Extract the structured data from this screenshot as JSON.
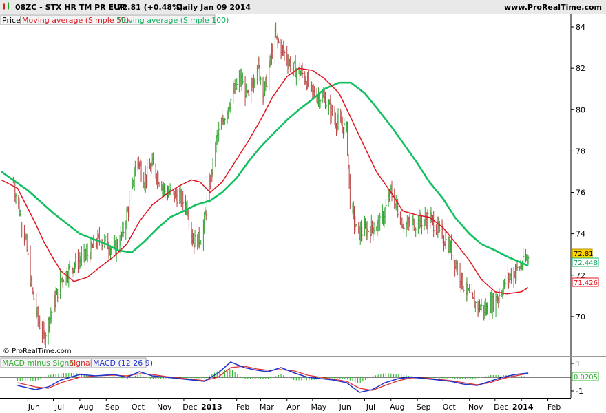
{
  "header": {
    "symbol": "08ZC - STX HR TM PR EUR",
    "price": "72.81 (+0.48%)",
    "period": "Daily  Jan 09 2014",
    "site": "www.ProRealTime.com"
  },
  "legend_main": {
    "price": "Price",
    "ma50": "Moving average (Simple 50)",
    "ma100": "Moving average (Simple 100)"
  },
  "legend_macd": {
    "hist": "MACD minus Signal",
    "signal": "Signal",
    "macd": "MACD (12 26 9)"
  },
  "watermark": "© ProRealTime.com",
  "colors": {
    "bars": "#2fa32f",
    "bars_down": "#b84040",
    "ma50": "#e0141e",
    "ma100": "#12c060",
    "macd": "#2233cc",
    "signal": "#e03030",
    "hist": "#33bb33",
    "last_price_bg": "#ffd400"
  },
  "chart_data": [
    {
      "type": "line",
      "subtype": "ohlc-bars",
      "title": "08ZC - STX HR TM PR EUR",
      "x_tick_labels": [
        "Jun",
        "Jul",
        "Aug",
        "Sep",
        "Oct",
        "Nov",
        "Dec",
        "2013",
        "Feb",
        "Mar",
        "Apr",
        "May",
        "Jun",
        "Jul",
        "Aug",
        "Sep",
        "Oct",
        "Nov",
        "Dec",
        "2014",
        "Feb"
      ],
      "y_tick_labels": [
        "70",
        "72",
        "74",
        "76",
        "78",
        "80",
        "82",
        "84"
      ],
      "ylim": [
        68.1,
        84.6
      ],
      "x_range": [
        "2012-05",
        "2014-02"
      ],
      "grid": false,
      "legend_position": "top-left",
      "price_path": [
        [
          "2012-05-15",
          76.5
        ],
        [
          "2012-05-30",
          73.5
        ],
        [
          "2012-06-05",
          71.5
        ],
        [
          "2012-06-12",
          70.0
        ],
        [
          "2012-06-20",
          69.0
        ],
        [
          "2012-07-01",
          70.5
        ],
        [
          "2012-07-10",
          71.8
        ],
        [
          "2012-07-25",
          72.5
        ],
        [
          "2012-08-10",
          73.0
        ],
        [
          "2012-08-25",
          73.8
        ],
        [
          "2012-09-10",
          73.2
        ],
        [
          "2012-09-20",
          74.0
        ],
        [
          "2012-10-01",
          76.0
        ],
        [
          "2012-10-07",
          77.8
        ],
        [
          "2012-10-15",
          76.6
        ],
        [
          "2012-10-25",
          77.3
        ],
        [
          "2012-11-10",
          76.0
        ],
        [
          "2012-11-25",
          75.8
        ],
        [
          "2012-12-05",
          75.3
        ],
        [
          "2012-12-12",
          73.6
        ],
        [
          "2012-12-22",
          73.8
        ],
        [
          "2013-01-01",
          76.5
        ],
        [
          "2013-01-08",
          78.5
        ],
        [
          "2013-01-22",
          80.2
        ],
        [
          "2013-02-05",
          81.5
        ],
        [
          "2013-02-15",
          80.5
        ],
        [
          "2013-02-25",
          82.3
        ],
        [
          "2013-03-05",
          80.8
        ],
        [
          "2013-03-18",
          83.5
        ],
        [
          "2013-03-25",
          83.0
        ],
        [
          "2013-04-08",
          82.0
        ],
        [
          "2013-04-20",
          81.7
        ],
        [
          "2013-05-01",
          80.8
        ],
        [
          "2013-05-15",
          80.5
        ],
        [
          "2013-05-28",
          79.5
        ],
        [
          "2013-06-10",
          79.0
        ],
        [
          "2013-06-14",
          75.6
        ],
        [
          "2013-06-22",
          74.0
        ],
        [
          "2013-07-05",
          74.2
        ],
        [
          "2013-07-20",
          74.5
        ],
        [
          "2013-08-01",
          76.0
        ],
        [
          "2013-08-15",
          74.5
        ],
        [
          "2013-09-01",
          74.5
        ],
        [
          "2013-09-15",
          74.8
        ],
        [
          "2013-09-25",
          74.2
        ],
        [
          "2013-10-10",
          73.3
        ],
        [
          "2013-10-25",
          71.5
        ],
        [
          "2013-11-05",
          70.7
        ],
        [
          "2013-11-20",
          70.3
        ],
        [
          "2013-12-05",
          71.0
        ],
        [
          "2013-12-15",
          71.8
        ],
        [
          "2013-12-25",
          72.2
        ],
        [
          "2014-01-09",
          72.81
        ]
      ],
      "series": [
        {
          "name": "Moving average (Simple 50)",
          "values": [
            [
              "2012-05-01",
              76.6
            ],
            [
              "2012-05-20",
              76.2
            ],
            [
              "2012-06-10",
              74.5
            ],
            [
              "2012-06-20",
              73.6
            ],
            [
              "2012-07-01",
              72.8
            ],
            [
              "2012-07-10",
              72.2
            ],
            [
              "2012-07-25",
              71.7
            ],
            [
              "2012-08-10",
              71.9
            ],
            [
              "2012-08-25",
              72.4
            ],
            [
              "2012-09-10",
              72.9
            ],
            [
              "2012-09-25",
              73.5
            ],
            [
              "2012-10-10",
              74.6
            ],
            [
              "2012-10-25",
              75.4
            ],
            [
              "2012-11-10",
              75.9
            ],
            [
              "2012-11-25",
              76.3
            ],
            [
              "2012-12-10",
              76.6
            ],
            [
              "2012-12-20",
              76.5
            ],
            [
              "2013-01-01",
              76.0
            ],
            [
              "2013-01-15",
              76.5
            ],
            [
              "2013-02-01",
              77.6
            ],
            [
              "2013-02-15",
              78.5
            ],
            [
              "2013-03-01",
              79.5
            ],
            [
              "2013-03-15",
              80.6
            ],
            [
              "2013-04-01",
              81.6
            ],
            [
              "2013-04-15",
              82.0
            ],
            [
              "2013-05-01",
              81.9
            ],
            [
              "2013-05-15",
              81.5
            ],
            [
              "2013-06-01",
              80.8
            ],
            [
              "2013-06-15",
              79.6
            ],
            [
              "2013-07-01",
              78.2
            ],
            [
              "2013-07-15",
              77.0
            ],
            [
              "2013-08-01",
              76.0
            ],
            [
              "2013-08-15",
              75.1
            ],
            [
              "2013-09-01",
              74.9
            ],
            [
              "2013-09-15",
              74.8
            ],
            [
              "2013-10-01",
              74.3
            ],
            [
              "2013-10-15",
              73.6
            ],
            [
              "2013-11-01",
              72.7
            ],
            [
              "2013-11-15",
              71.8
            ],
            [
              "2013-12-01",
              71.2
            ],
            [
              "2013-12-15",
              71.1
            ],
            [
              "2014-01-01",
              71.2
            ],
            [
              "2014-01-09",
              71.4
            ]
          ]
        },
        {
          "name": "Moving average (Simple 100)",
          "values": [
            [
              "2012-05-01",
              77.0
            ],
            [
              "2012-06-01",
              76.1
            ],
            [
              "2012-07-01",
              75.0
            ],
            [
              "2012-08-01",
              74.0
            ],
            [
              "2012-09-01",
              73.5
            ],
            [
              "2012-09-15",
              73.2
            ],
            [
              "2012-10-01",
              73.1
            ],
            [
              "2012-10-15",
              73.6
            ],
            [
              "2012-11-01",
              74.3
            ],
            [
              "2012-11-15",
              74.8
            ],
            [
              "2012-12-01",
              75.1
            ],
            [
              "2012-12-15",
              75.4
            ],
            [
              "2013-01-01",
              75.6
            ],
            [
              "2013-01-15",
              76.0
            ],
            [
              "2013-02-01",
              76.7
            ],
            [
              "2013-02-15",
              77.5
            ],
            [
              "2013-03-01",
              78.2
            ],
            [
              "2013-03-15",
              78.8
            ],
            [
              "2013-04-01",
              79.5
            ],
            [
              "2013-04-15",
              80.0
            ],
            [
              "2013-05-01",
              80.5
            ],
            [
              "2013-05-15",
              81.0
            ],
            [
              "2013-06-01",
              81.3
            ],
            [
              "2013-06-15",
              81.3
            ],
            [
              "2013-07-01",
              80.8
            ],
            [
              "2013-07-15",
              80.1
            ],
            [
              "2013-08-01",
              79.2
            ],
            [
              "2013-08-15",
              78.4
            ],
            [
              "2013-09-01",
              77.4
            ],
            [
              "2013-09-15",
              76.5
            ],
            [
              "2013-10-01",
              75.7
            ],
            [
              "2013-10-15",
              74.8
            ],
            [
              "2013-11-01",
              74.0
            ],
            [
              "2013-11-15",
              73.5
            ],
            [
              "2013-12-01",
              73.2
            ],
            [
              "2013-12-15",
              72.9
            ],
            [
              "2014-01-01",
              72.6
            ],
            [
              "2014-01-09",
              72.45
            ]
          ]
        }
      ],
      "last_values": {
        "price": "72.81",
        "ma100": "72.448",
        "ma50": "71.426"
      }
    },
    {
      "type": "line",
      "title": "MACD (12 26 9)",
      "y_tick_labels": [
        "1",
        "-1"
      ],
      "ylim": [
        -1.4,
        1.3
      ],
      "series": [
        {
          "name": "MACD (12 26 9)",
          "values": [
            [
              "2012-05-20",
              -0.6
            ],
            [
              "2012-06-10",
              -0.9
            ],
            [
              "2012-06-25",
              -0.7
            ],
            [
              "2012-07-10",
              -0.2
            ],
            [
              "2012-08-01",
              0.2
            ],
            [
              "2012-08-20",
              0.1
            ],
            [
              "2012-09-10",
              0.2
            ],
            [
              "2012-09-25",
              0.0
            ],
            [
              "2012-10-10",
              0.4
            ],
            [
              "2012-10-25",
              0.1
            ],
            [
              "2012-11-10",
              0.0
            ],
            [
              "2012-11-25",
              -0.1
            ],
            [
              "2012-12-10",
              -0.2
            ],
            [
              "2012-12-25",
              -0.3
            ],
            [
              "2013-01-10",
              0.3
            ],
            [
              "2013-01-25",
              1.1
            ],
            [
              "2013-02-10",
              0.7
            ],
            [
              "2013-02-25",
              0.5
            ],
            [
              "2013-03-10",
              0.4
            ],
            [
              "2013-03-25",
              0.7
            ],
            [
              "2013-04-10",
              0.3
            ],
            [
              "2013-04-25",
              0.0
            ],
            [
              "2013-05-10",
              -0.1
            ],
            [
              "2013-05-25",
              -0.2
            ],
            [
              "2013-06-10",
              -0.4
            ],
            [
              "2013-06-25",
              -1.1
            ],
            [
              "2013-07-10",
              -0.9
            ],
            [
              "2013-07-25",
              -0.4
            ],
            [
              "2013-08-10",
              -0.1
            ],
            [
              "2013-08-25",
              0.0
            ],
            [
              "2013-09-10",
              -0.1
            ],
            [
              "2013-09-25",
              -0.2
            ],
            [
              "2013-10-10",
              -0.3
            ],
            [
              "2013-10-25",
              -0.5
            ],
            [
              "2013-11-10",
              -0.6
            ],
            [
              "2013-11-25",
              -0.3
            ],
            [
              "2013-12-10",
              0.0
            ],
            [
              "2013-12-25",
              0.2
            ],
            [
              "2014-01-09",
              0.3
            ]
          ]
        },
        {
          "name": "Signal",
          "values": [
            [
              "2012-05-20",
              -0.4
            ],
            [
              "2012-06-10",
              -0.7
            ],
            [
              "2012-06-25",
              -0.8
            ],
            [
              "2012-07-10",
              -0.4
            ],
            [
              "2012-08-01",
              0.0
            ],
            [
              "2012-08-20",
              0.1
            ],
            [
              "2012-09-10",
              0.15
            ],
            [
              "2012-09-25",
              0.1
            ],
            [
              "2012-10-10",
              0.25
            ],
            [
              "2012-10-25",
              0.2
            ],
            [
              "2012-11-10",
              0.05
            ],
            [
              "2012-11-25",
              -0.05
            ],
            [
              "2012-12-10",
              -0.15
            ],
            [
              "2012-12-25",
              -0.25
            ],
            [
              "2013-01-10",
              0.0
            ],
            [
              "2013-01-25",
              0.7
            ],
            [
              "2013-02-10",
              0.8
            ],
            [
              "2013-02-25",
              0.6
            ],
            [
              "2013-03-10",
              0.5
            ],
            [
              "2013-03-25",
              0.55
            ],
            [
              "2013-04-10",
              0.45
            ],
            [
              "2013-04-25",
              0.15
            ],
            [
              "2013-05-10",
              0.0
            ],
            [
              "2013-05-25",
              -0.15
            ],
            [
              "2013-06-10",
              -0.3
            ],
            [
              "2013-06-25",
              -0.8
            ],
            [
              "2013-07-10",
              -0.95
            ],
            [
              "2013-07-25",
              -0.6
            ],
            [
              "2013-08-10",
              -0.25
            ],
            [
              "2013-08-25",
              -0.05
            ],
            [
              "2013-09-10",
              -0.05
            ],
            [
              "2013-09-25",
              -0.15
            ],
            [
              "2013-10-10",
              -0.25
            ],
            [
              "2013-10-25",
              -0.4
            ],
            [
              "2013-11-10",
              -0.55
            ],
            [
              "2013-11-25",
              -0.4
            ],
            [
              "2013-12-10",
              -0.1
            ],
            [
              "2013-12-25",
              0.1
            ],
            [
              "2014-01-09",
              0.28
            ]
          ]
        }
      ],
      "last_values": {
        "hist": "0.0205"
      }
    }
  ]
}
